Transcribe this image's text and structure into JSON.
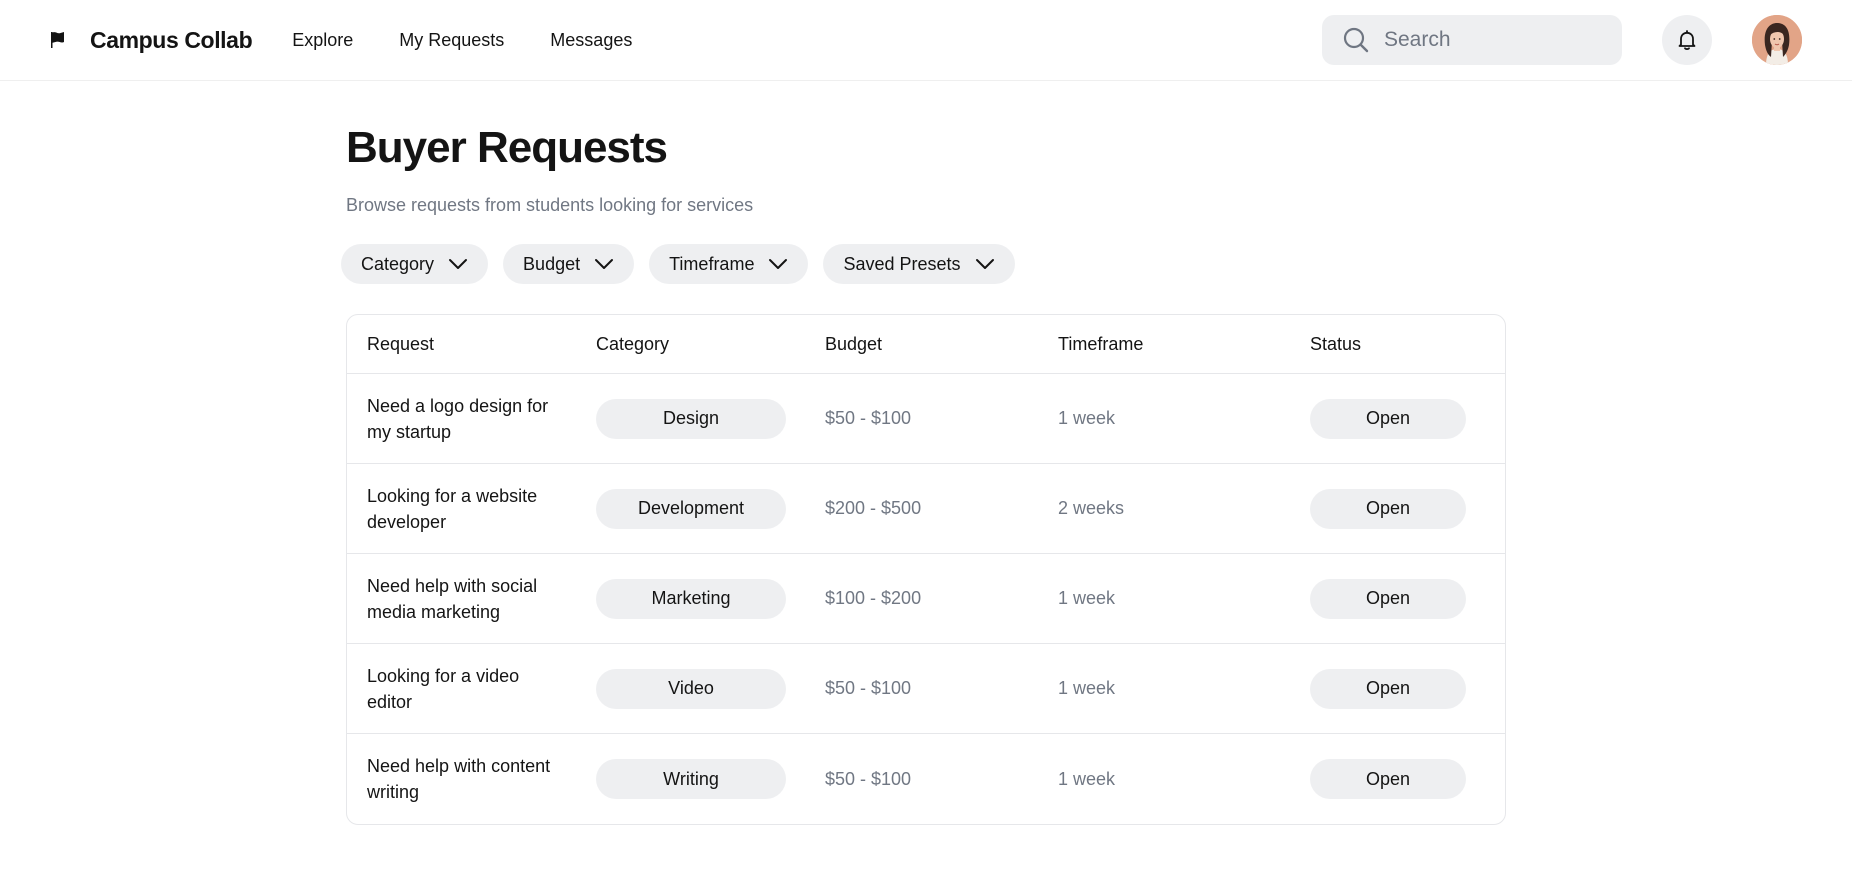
{
  "app": {
    "brand_name": "Campus Collab"
  },
  "nav": {
    "links": [
      {
        "label": "Explore"
      },
      {
        "label": "My Requests"
      },
      {
        "label": "Messages"
      }
    ]
  },
  "search": {
    "placeholder": "Search",
    "value": ""
  },
  "icons": {
    "brand": "flag-icon",
    "search": "search-icon",
    "notifications": "bell-icon",
    "chevron": "chevron-down-icon"
  },
  "page": {
    "title": "Buyer Requests",
    "subtitle": "Browse requests from students looking for services"
  },
  "filters": [
    {
      "label": "Category"
    },
    {
      "label": "Budget"
    },
    {
      "label": "Timeframe"
    },
    {
      "label": "Saved Presets"
    }
  ],
  "table": {
    "headers": [
      "Request",
      "Category",
      "Budget",
      "Timeframe",
      "Status"
    ],
    "rows": [
      {
        "request": "Need a logo design for my startup",
        "category": "Design",
        "budget": "$50 - $100",
        "timeframe": "1 week",
        "status": "Open"
      },
      {
        "request": "Looking for a website developer",
        "category": "Development",
        "budget": "$200 - $500",
        "timeframe": "2 weeks",
        "status": "Open"
      },
      {
        "request": "Need help with social media marketing",
        "category": "Marketing",
        "budget": "$100 - $200",
        "timeframe": "1 week",
        "status": "Open"
      },
      {
        "request": "Looking for a video editor",
        "category": "Video",
        "budget": "$50 - $100",
        "timeframe": "1 week",
        "status": "Open"
      },
      {
        "request": "Need help with content writing",
        "category": "Writing",
        "budget": "$50 - $100",
        "timeframe": "1 week",
        "status": "Open"
      }
    ]
  },
  "colors": {
    "text": "#141414",
    "muted": "#707783",
    "pill_bg": "#eeeff1",
    "border": "#e6e7ea",
    "avatar_bg": "#e2a487"
  }
}
